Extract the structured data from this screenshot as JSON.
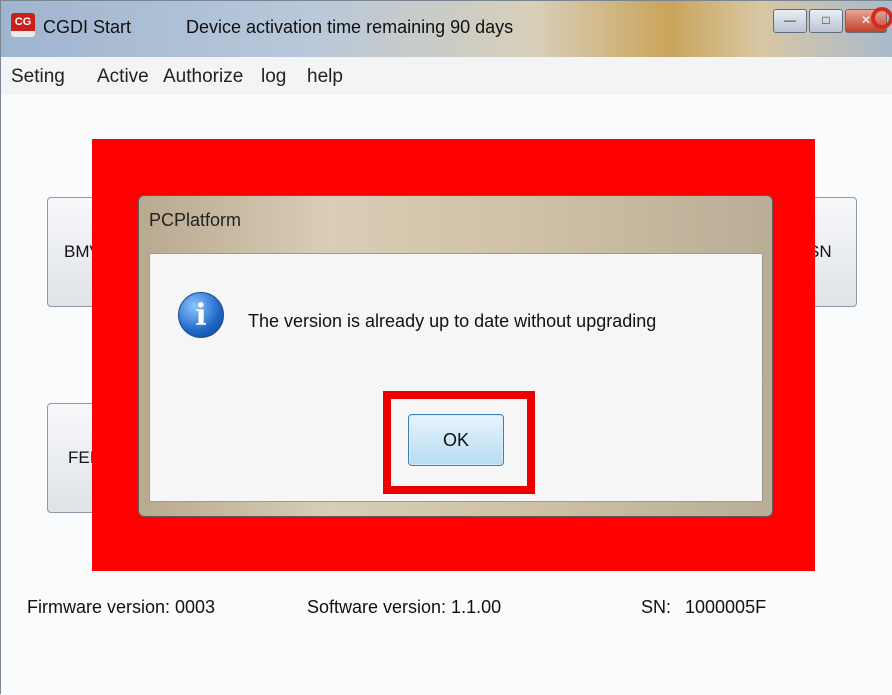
{
  "window": {
    "app_title": "CGDI Start",
    "activation_notice": "Device activation time remaining 90 days",
    "logo_text": "CG"
  },
  "menu": {
    "items": [
      "Seting",
      "Active",
      "Authorize",
      "log",
      "help"
    ]
  },
  "main_buttons": {
    "bmw_partial": "BMV",
    "fem_partial": "FEI",
    "sn_partial": "SN"
  },
  "dialog": {
    "title": "PCPlatform",
    "message": "The version is already up to date without upgrading",
    "ok_label": "OK",
    "icon": "info-icon"
  },
  "status_bar": {
    "firmware": "Firmware version: 0003",
    "software": "Software version:  1.1.00",
    "sn_label": "SN:",
    "sn_value": "1000005F"
  },
  "colors": {
    "highlight_red": "#ff0000",
    "ok_button": "#b7dcf3"
  }
}
